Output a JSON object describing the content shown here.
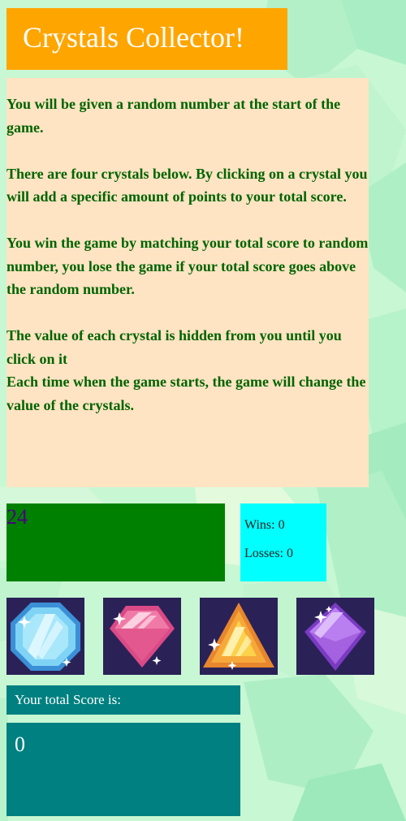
{
  "title": "Crystals Collector!",
  "instructions": [
    "You will be given a random number at the start of the game.",
    "There are four crystals below. By clicking on a crystal you will add a specific amount of points to your total score.",
    "You win the game by matching your total score to random number, you lose the game if your total score goes above the random number.",
    "The value of each crystal is hidden from you until you click on it",
    "Each time when the game starts, the game will change the value of the crystals."
  ],
  "random_number": "24",
  "stats": {
    "wins": "Wins: 0",
    "losses": "Losses: 0"
  },
  "crystals": [
    {
      "icon": "blue-octagon-crystal-icon"
    },
    {
      "icon": "pink-diamond-crystal-icon"
    },
    {
      "icon": "orange-triangle-crystal-icon"
    },
    {
      "icon": "purple-rhombus-crystal-icon"
    }
  ],
  "score": {
    "label": "Your total Score is:",
    "value": "0"
  },
  "colors": {
    "title_bg": "#ffa500",
    "instructions_bg": "#ffe4c4",
    "instructions_text": "#006400",
    "random_bg": "#008000",
    "stats_bg": "#00ffff",
    "score_bg": "#008080",
    "crystal_bg": "#2a2157"
  }
}
